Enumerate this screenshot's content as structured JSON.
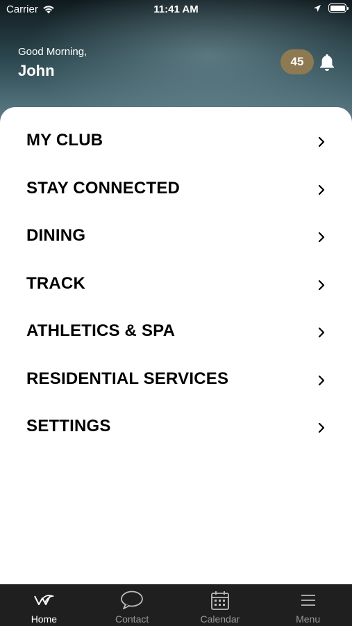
{
  "status_bar": {
    "carrier": "Carrier",
    "time": "11:41 AM"
  },
  "header": {
    "greeting": "Good Morning,",
    "username": "John",
    "notification_count": "45"
  },
  "menu": {
    "items": [
      {
        "label": "MY CLUB"
      },
      {
        "label": "STAY CONNECTED"
      },
      {
        "label": "DINING"
      },
      {
        "label": "TRACK"
      },
      {
        "label": "ATHLETICS & SPA"
      },
      {
        "label": "RESIDENTIAL SERVICES"
      },
      {
        "label": "SETTINGS"
      }
    ]
  },
  "tab_bar": {
    "tabs": [
      {
        "label": "Home",
        "icon": "club-logo-icon",
        "active": true
      },
      {
        "label": "Contact",
        "icon": "chat-bubble-icon",
        "active": false
      },
      {
        "label": "Calendar",
        "icon": "calendar-icon",
        "active": false
      },
      {
        "label": "Menu",
        "icon": "hamburger-menu-icon",
        "active": false
      }
    ]
  },
  "colors": {
    "badge": "#8e7a52",
    "tab_bar_bg": "#1f1f1f",
    "header_gradient_top": "#0f1a1e",
    "header_gradient_bottom": "#6d8f99"
  }
}
